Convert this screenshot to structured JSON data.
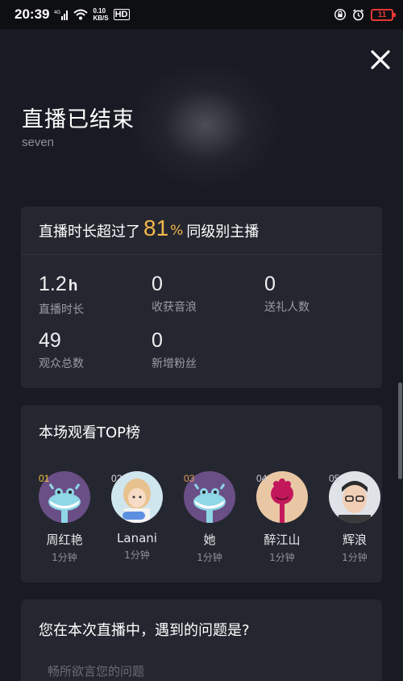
{
  "status_bar": {
    "time": "20:39",
    "signal": "4G",
    "net_speed_value": "0.10",
    "net_speed_unit": "KB/S",
    "hd": "HD",
    "battery": "11"
  },
  "header": {
    "title": "直播已结束",
    "subtitle": "seven"
  },
  "summary": {
    "prefix": "直播时长超过了",
    "percent": "81",
    "percent_sign": "%",
    "suffix": "同级别主播",
    "stats": [
      {
        "value": "1.2",
        "unit": "h",
        "label": "直播时长"
      },
      {
        "value": "0",
        "unit": "",
        "label": "收获音浪"
      },
      {
        "value": "0",
        "unit": "",
        "label": "送礼人数"
      },
      {
        "value": "49",
        "unit": "",
        "label": "观众总数"
      },
      {
        "value": "0",
        "unit": "",
        "label": "新增粉丝"
      }
    ]
  },
  "top_list": {
    "title": "本场观看TOP榜",
    "viewers": [
      {
        "rank": "01",
        "name": "周红艳",
        "time": "1分钟"
      },
      {
        "rank": "02",
        "name": "Lanani",
        "time": "1分钟"
      },
      {
        "rank": "03",
        "name": "她",
        "time": "1分钟"
      },
      {
        "rank": "04",
        "name": "醉江山",
        "time": "1分钟"
      },
      {
        "rank": "05",
        "name": "辉浪",
        "time": "1分钟"
      }
    ]
  },
  "feedback": {
    "question": "您在本次直播中，遇到的问题是?",
    "placeholder": "畅所欲言您的问题"
  },
  "colors": {
    "background": "#191b24",
    "card": "#252730",
    "accent_gold": "#f5b94a"
  }
}
